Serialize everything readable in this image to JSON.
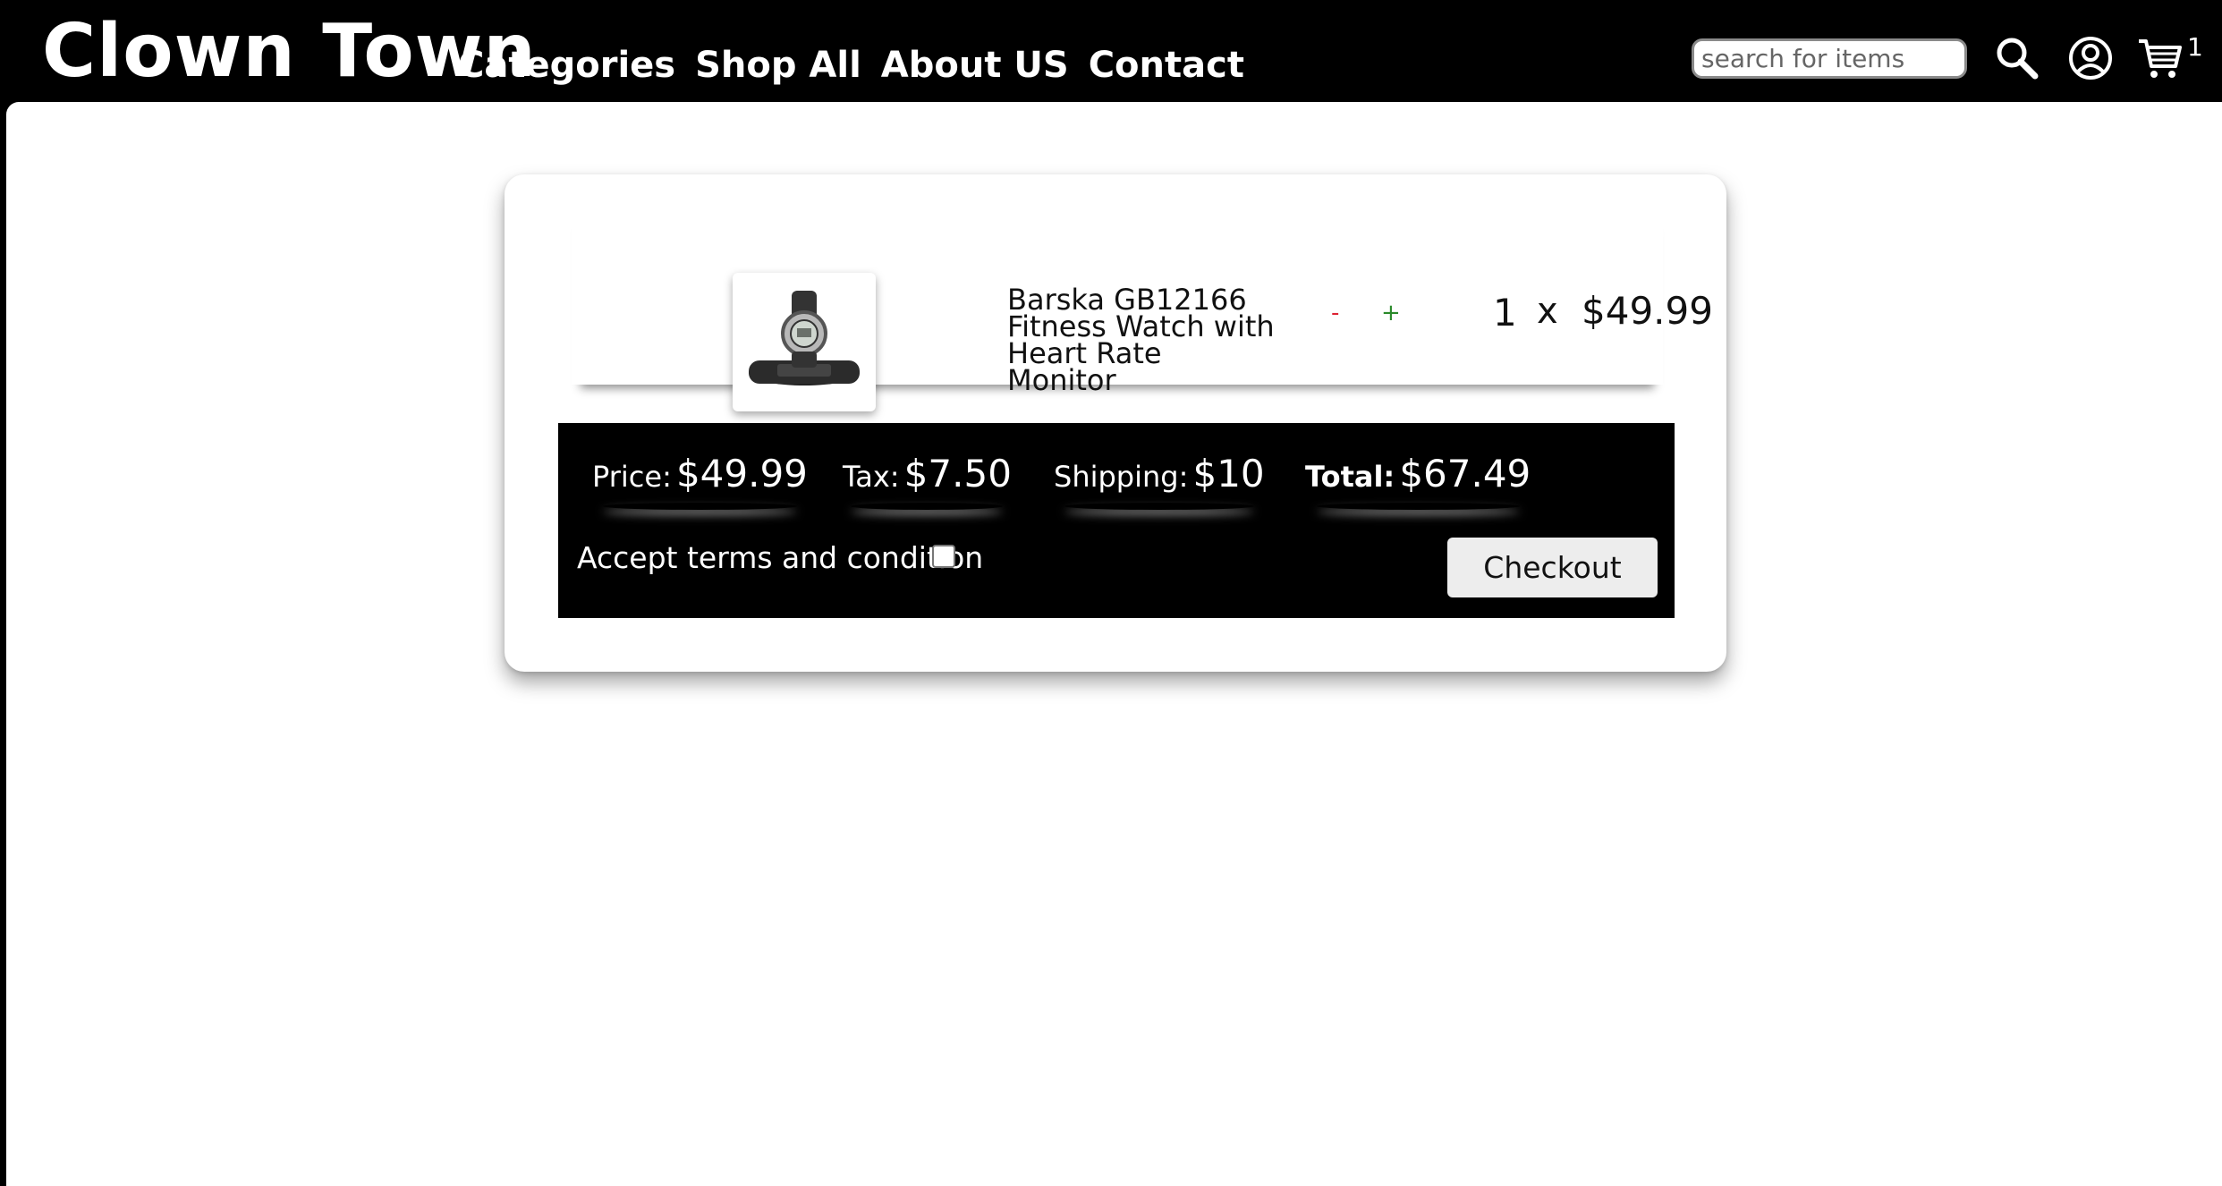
{
  "brand": "Clown Town",
  "nav": [
    {
      "label": "Categories"
    },
    {
      "label": "Shop All"
    },
    {
      "label": "About US"
    },
    {
      "label": "Contact"
    }
  ],
  "search": {
    "placeholder": "search for items",
    "value": ""
  },
  "icons": {
    "search": "search-icon",
    "account": "user-circle-icon",
    "cart": "shopping-cart-icon"
  },
  "cart": {
    "count": "1"
  },
  "item": {
    "name": "Barska GB12166 Fitness Watch with Heart Rate Monitor",
    "decrement": "-",
    "increment": "+",
    "quantity": "1",
    "times": "x",
    "unit_price": "$49.99"
  },
  "summary": {
    "price_label": "Price:",
    "price": "$49.99",
    "tax_label": "Tax:",
    "tax": "$7.50",
    "shipping_label": "Shipping:",
    "shipping": "$10",
    "total_label": "Total:",
    "total": "$67.49",
    "terms_label": "Accept terms and condition",
    "terms_checked": false,
    "checkout_label": "Checkout"
  },
  "colors": {
    "header_bg": "#000000",
    "decrement": "#dd2233",
    "increment": "#2a8a2a",
    "summary_bg": "#000000"
  }
}
